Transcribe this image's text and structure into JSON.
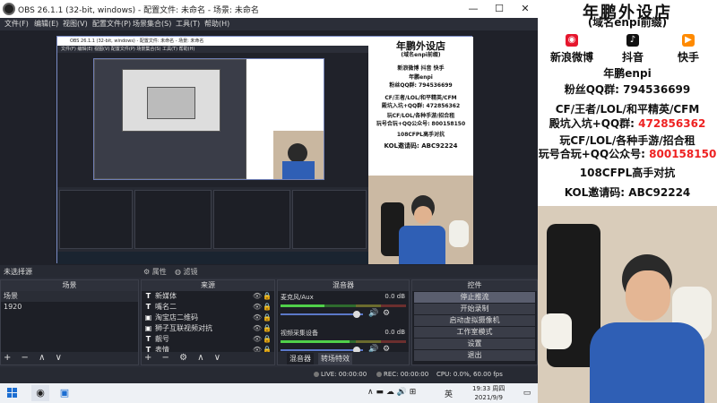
{
  "window": {
    "title": "OBS 26.1.1 (32-bit, windows) - 配置文件: 未命名 - 场景: 未命名",
    "minimize": "—",
    "maximize": "☐",
    "close": "✕"
  },
  "menu": [
    "文件(F)",
    "编辑(E)",
    "视图(V)",
    "配置文件(P)",
    "场景集合(S)",
    "工具(T)",
    "帮助(H)"
  ],
  "preview": {
    "nested_title": "OBS 26.1.1 (32-bit, windows) - 配置文件: 未命名 - 场景: 未命名",
    "nested_menu": "文件(F)  编辑(E)  视图(V)  配置文件(P)  场景集合(S)  工具(T)  帮助(H)",
    "promo": {
      "shop": "年鹏外设店",
      "domain": "(域名enpi前缀)",
      "weibo": "新浪微博",
      "douyin": "抖音",
      "kuaishou": "快手",
      "nick": "年鹏enpi",
      "qq_group": "粉丝QQ群: 794536699",
      "games": "CF/王者/LOL/和平精英/CFM",
      "recruit": "殿坑入坑+QQ群: 472856362",
      "play": "玩CF/LOL/各种手游/招合租",
      "play2": "玩号合玩+QQ公众号: 800158150",
      "cfpl": "108CFPL高手对抗",
      "kol": "KOL邀请码: ABC92224"
    }
  },
  "source_toolbar": {
    "no_source": "未选择源",
    "properties": "属性",
    "filters": "滤镜"
  },
  "scenes": {
    "header": "场景",
    "items": [
      "场景",
      "1920"
    ],
    "footer": "+ − ∧ ∨"
  },
  "sources": {
    "header": "来源",
    "items": [
      {
        "icon": "T",
        "label": "新媒体"
      },
      {
        "icon": "T",
        "label": "嘴名二"
      },
      {
        "icon": "▣",
        "label": "淘宝店二维码"
      },
      {
        "icon": "▣",
        "label": "狮子互联视频对抗"
      },
      {
        "icon": "T",
        "label": "靓号"
      },
      {
        "icon": "T",
        "label": "表情"
      }
    ],
    "footer": "+ − ⚙ ∧ ∨"
  },
  "mixer": {
    "header": "混音器",
    "channels": [
      {
        "name": "麦克风/Aux",
        "db": "0.0 dB",
        "level": 0.35,
        "volume": 0.92
      },
      {
        "name": "视频采集设备",
        "db": "0.0 dB",
        "level": 0.55,
        "volume": 0.92
      }
    ],
    "tabs": [
      "混音器",
      "转场特效"
    ]
  },
  "controls": {
    "header": "控件",
    "buttons": [
      "停止推流",
      "开始录制",
      "启动虚拟摄像机",
      "工作室模式",
      "设置",
      "退出"
    ],
    "active_index": 0
  },
  "status": {
    "live": "LIVE: 00:00:00",
    "rec": "REC: 00:00:00",
    "cpu": "CPU: 0.0%, 60.00 fps"
  },
  "taskbar": {
    "ime": "英",
    "time": "19:33 周四",
    "date": "2021/9/9",
    "tray_icons": "∧  ▬  ☁  🔊  ⊞"
  },
  "promo": {
    "shop": "年鹏外设店",
    "domain": "(域名enpi前缀)",
    "weibo": "新浪微博",
    "douyin": "抖音",
    "kuaishou": "快手",
    "nick": "年鹏enpi",
    "qq_group": "粉丝QQ群: 794536699",
    "games": "CF/王者/LOL/和平精英/CFM",
    "recruit_label": "殿坑入坑+QQ群:",
    "recruit_num": "472856362",
    "play": "玩CF/LOL/各种手游/招合租",
    "play2_label": "玩号合玩+QQ公众号:",
    "play2_num": "800158150",
    "cfpl": "108CFPL高手对抗",
    "kol": "KOL邀请码: ABC92224",
    "colors": {
      "weibo": "#e6162d",
      "douyin": "#111111",
      "kuaishou": "#ff8a00",
      "accent_red": "#ee2222"
    }
  }
}
